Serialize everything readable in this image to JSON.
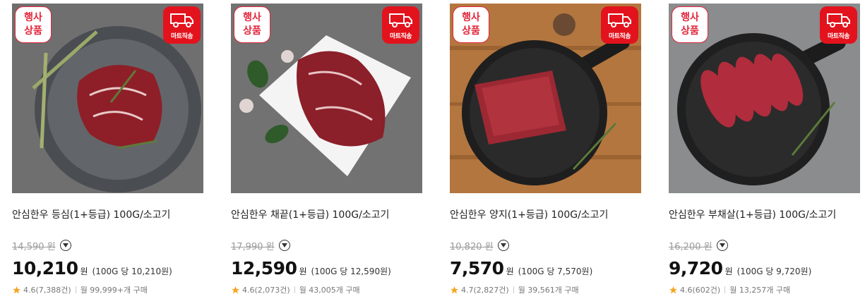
{
  "badges": {
    "event_line1": "행사",
    "event_line2": "상품",
    "mart_label": "마트직송"
  },
  "colors": {
    "accent": "#e3131d",
    "star": "#f5a623"
  },
  "products": [
    {
      "name": "안심한우 등심(1+등급) 100G/소고기",
      "original_price": "14,590 원",
      "price": "10,210",
      "won": "원",
      "unit_price": "(100G 당 10,210원)",
      "rating": "4.6(7,388건)",
      "purchases": "월 99,999+개 구매",
      "image": "beef-ribeye-on-tray"
    },
    {
      "name": "안심한우 채끝(1+등급) 100G/소고기",
      "original_price": "17,990 원",
      "price": "12,590",
      "won": "원",
      "unit_price": "(100G 당 12,590원)",
      "rating": "4.6(2,073건)",
      "purchases": "월 43,005개 구매",
      "image": "beef-striploin-on-plate"
    },
    {
      "name": "안심한우 양지(1+등급) 100G/소고기",
      "original_price": "10,820 원",
      "price": "7,570",
      "won": "원",
      "unit_price": "(100G 당 7,570원)",
      "rating": "4.7(2,827건)",
      "purchases": "월 39,561개 구매",
      "image": "beef-brisket-on-pan"
    },
    {
      "name": "안심한우 부채살(1+등급) 100G/소고기",
      "original_price": "16,200 원",
      "price": "9,720",
      "won": "원",
      "unit_price": "(100G 당 9,720원)",
      "rating": "4.6(602건)",
      "purchases": "월 13,257개 구매",
      "image": "beef-topblade-slices-on-pan"
    }
  ]
}
